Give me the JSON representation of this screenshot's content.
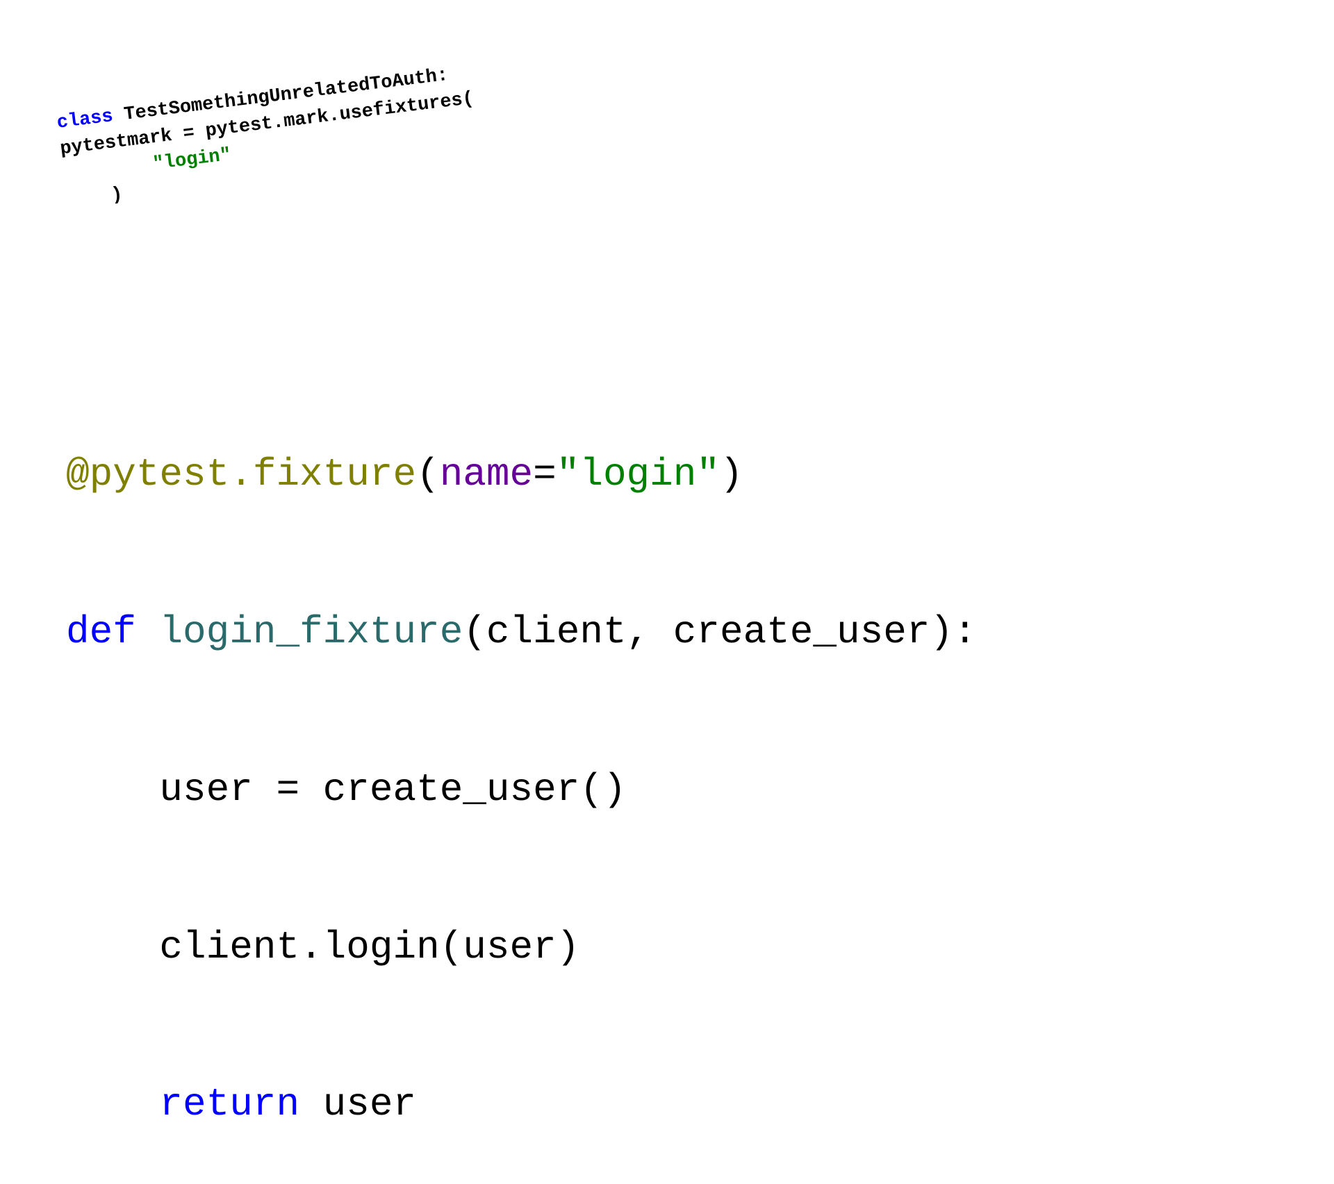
{
  "small_code": {
    "l1_kw": "class",
    "l1_rest": " TestSomethingUnrelatedToAuth:",
    "l2": "    pytestmark = pytest.mark.usefixtures(",
    "l3_indent": "        ",
    "l3_str": "\"login\"",
    "l4": "    )"
  },
  "large_code": {
    "l1_at": "@pytest.fixture",
    "l1_paren1": "(",
    "l1_name": "name",
    "l1_eq": "=",
    "l1_str": "\"login\"",
    "l1_paren2": ")",
    "l2_def": "def",
    "l2_sp": " ",
    "l2_fn": "login_fixture",
    "l2_rest": "(client, create_user):",
    "l3": "    user = create_user()",
    "l4": "    client.login(user)",
    "l5_indent": "    ",
    "l5_ret": "return",
    "l5_rest": " user"
  }
}
